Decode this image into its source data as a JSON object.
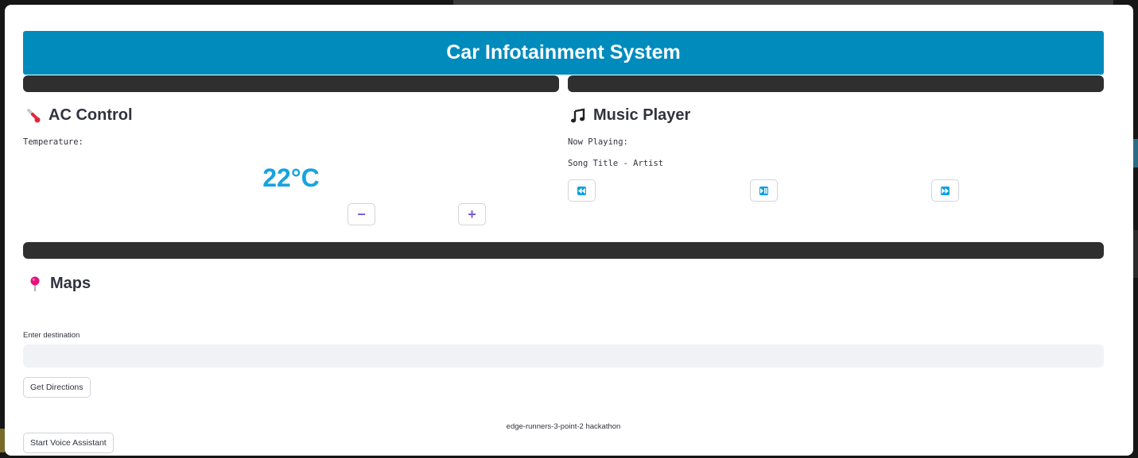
{
  "app": {
    "title": "Car Infotainment System",
    "accent_color": "#008bbd",
    "temperature_color": "#16a4e0",
    "button_glyph_color": "#7b5cd6"
  },
  "ac_control": {
    "heading": "AC Control",
    "icon": "thermometer-icon",
    "temperature_label": "Temperature:",
    "temperature_value": "22°C",
    "decrease_label": "−",
    "increase_label": "+"
  },
  "music_player": {
    "heading": "Music Player",
    "icon": "music-note-icon",
    "now_playing_label": "Now Playing:",
    "track": "Song Title - Artist",
    "controls": [
      "previous-track-icon",
      "play-pause-icon",
      "next-track-icon"
    ]
  },
  "maps": {
    "heading": "Maps",
    "icon": "map-pin-icon",
    "destination_label": "Enter destination",
    "destination_value": "",
    "directions_button": "Get Directions"
  },
  "voice": {
    "button": "Start Voice Assistant"
  },
  "footer": {
    "text": "edge-runners-3-point-2 hackathon"
  }
}
